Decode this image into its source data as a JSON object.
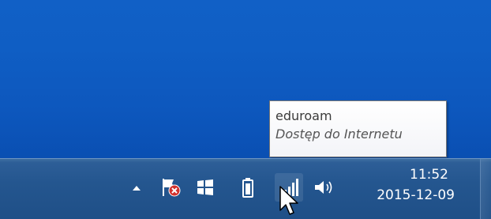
{
  "tooltip": {
    "network_name": "eduroam",
    "status": "Dostęp do Internetu"
  },
  "clock": {
    "time": "11:52",
    "date": "2015-12-09"
  },
  "tray": {
    "icons": [
      "chevron-up-icon",
      "action-center-flag-icon",
      "windows-logo-icon",
      "battery-icon",
      "wifi-signal-icon",
      "volume-icon"
    ]
  },
  "colors": {
    "desktop": "#1160c6",
    "taskbar": "#24568f"
  }
}
